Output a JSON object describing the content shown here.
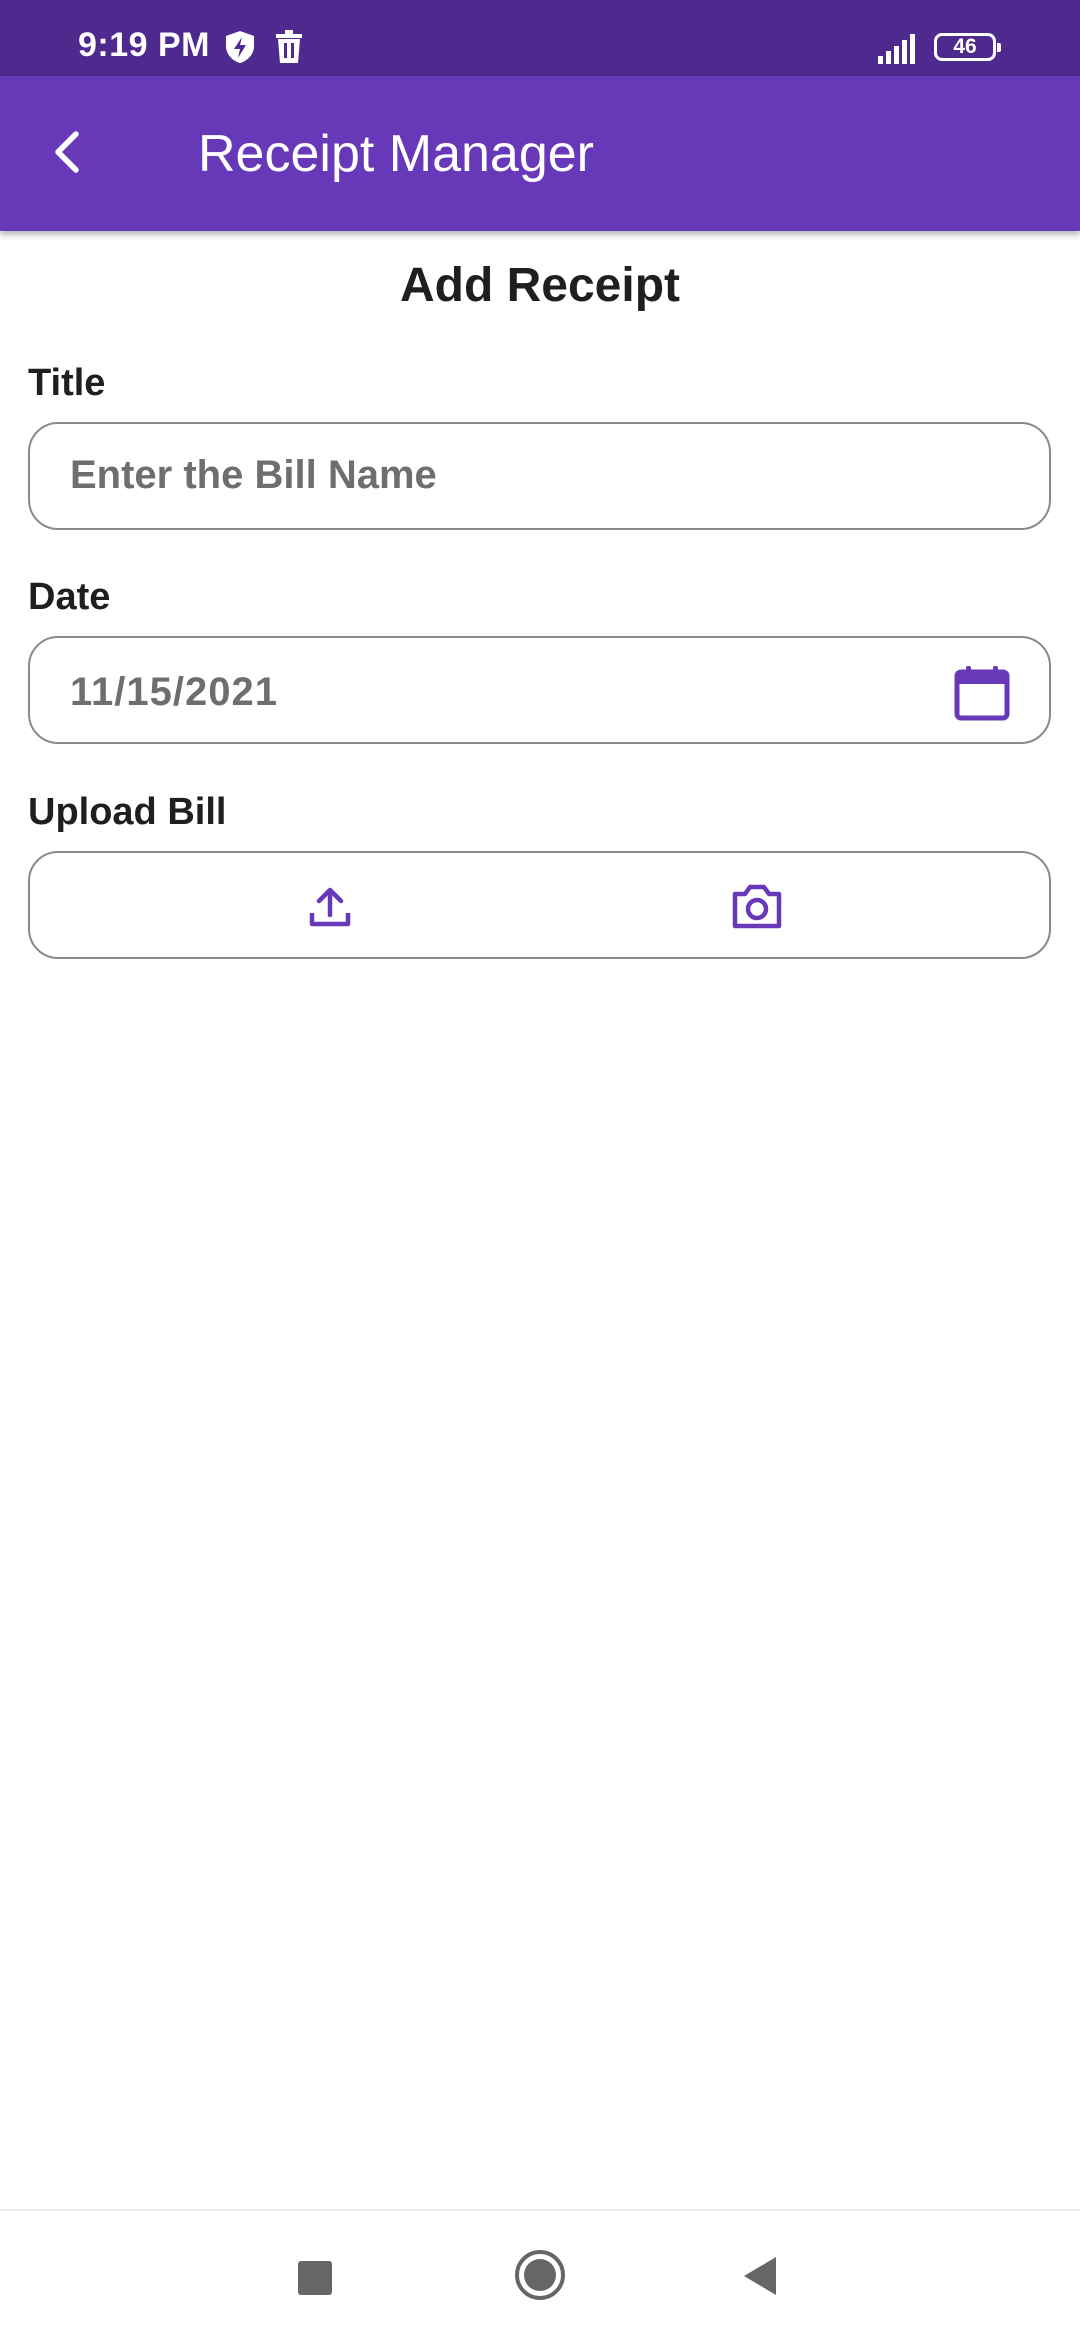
{
  "status_bar": {
    "time": "9:19 PM",
    "battery": "46",
    "icons": [
      "shield-icon",
      "trash-icon",
      "signal-icon",
      "battery-icon"
    ]
  },
  "app_bar": {
    "title": "Receipt Manager",
    "back_icon": "chevron-left-icon",
    "color": "#6738b8"
  },
  "form": {
    "heading": "Add Receipt",
    "title_field": {
      "label": "Title",
      "placeholder": "Enter the Bill Name",
      "value": ""
    },
    "date_field": {
      "label": "Date",
      "value": "11/15/2021",
      "icon": "calendar-icon"
    },
    "upload_field": {
      "label": "Upload Bill",
      "icons": [
        "upload-icon",
        "camera-icon"
      ]
    }
  },
  "nav_bar": {
    "icons": [
      "recents-icon",
      "home-icon",
      "back-icon"
    ]
  },
  "colors": {
    "status_bar": "#4e2a8e",
    "accent": "#6738b8",
    "field_border": "#8a8a8a",
    "muted_text": "#6e6e6e"
  }
}
